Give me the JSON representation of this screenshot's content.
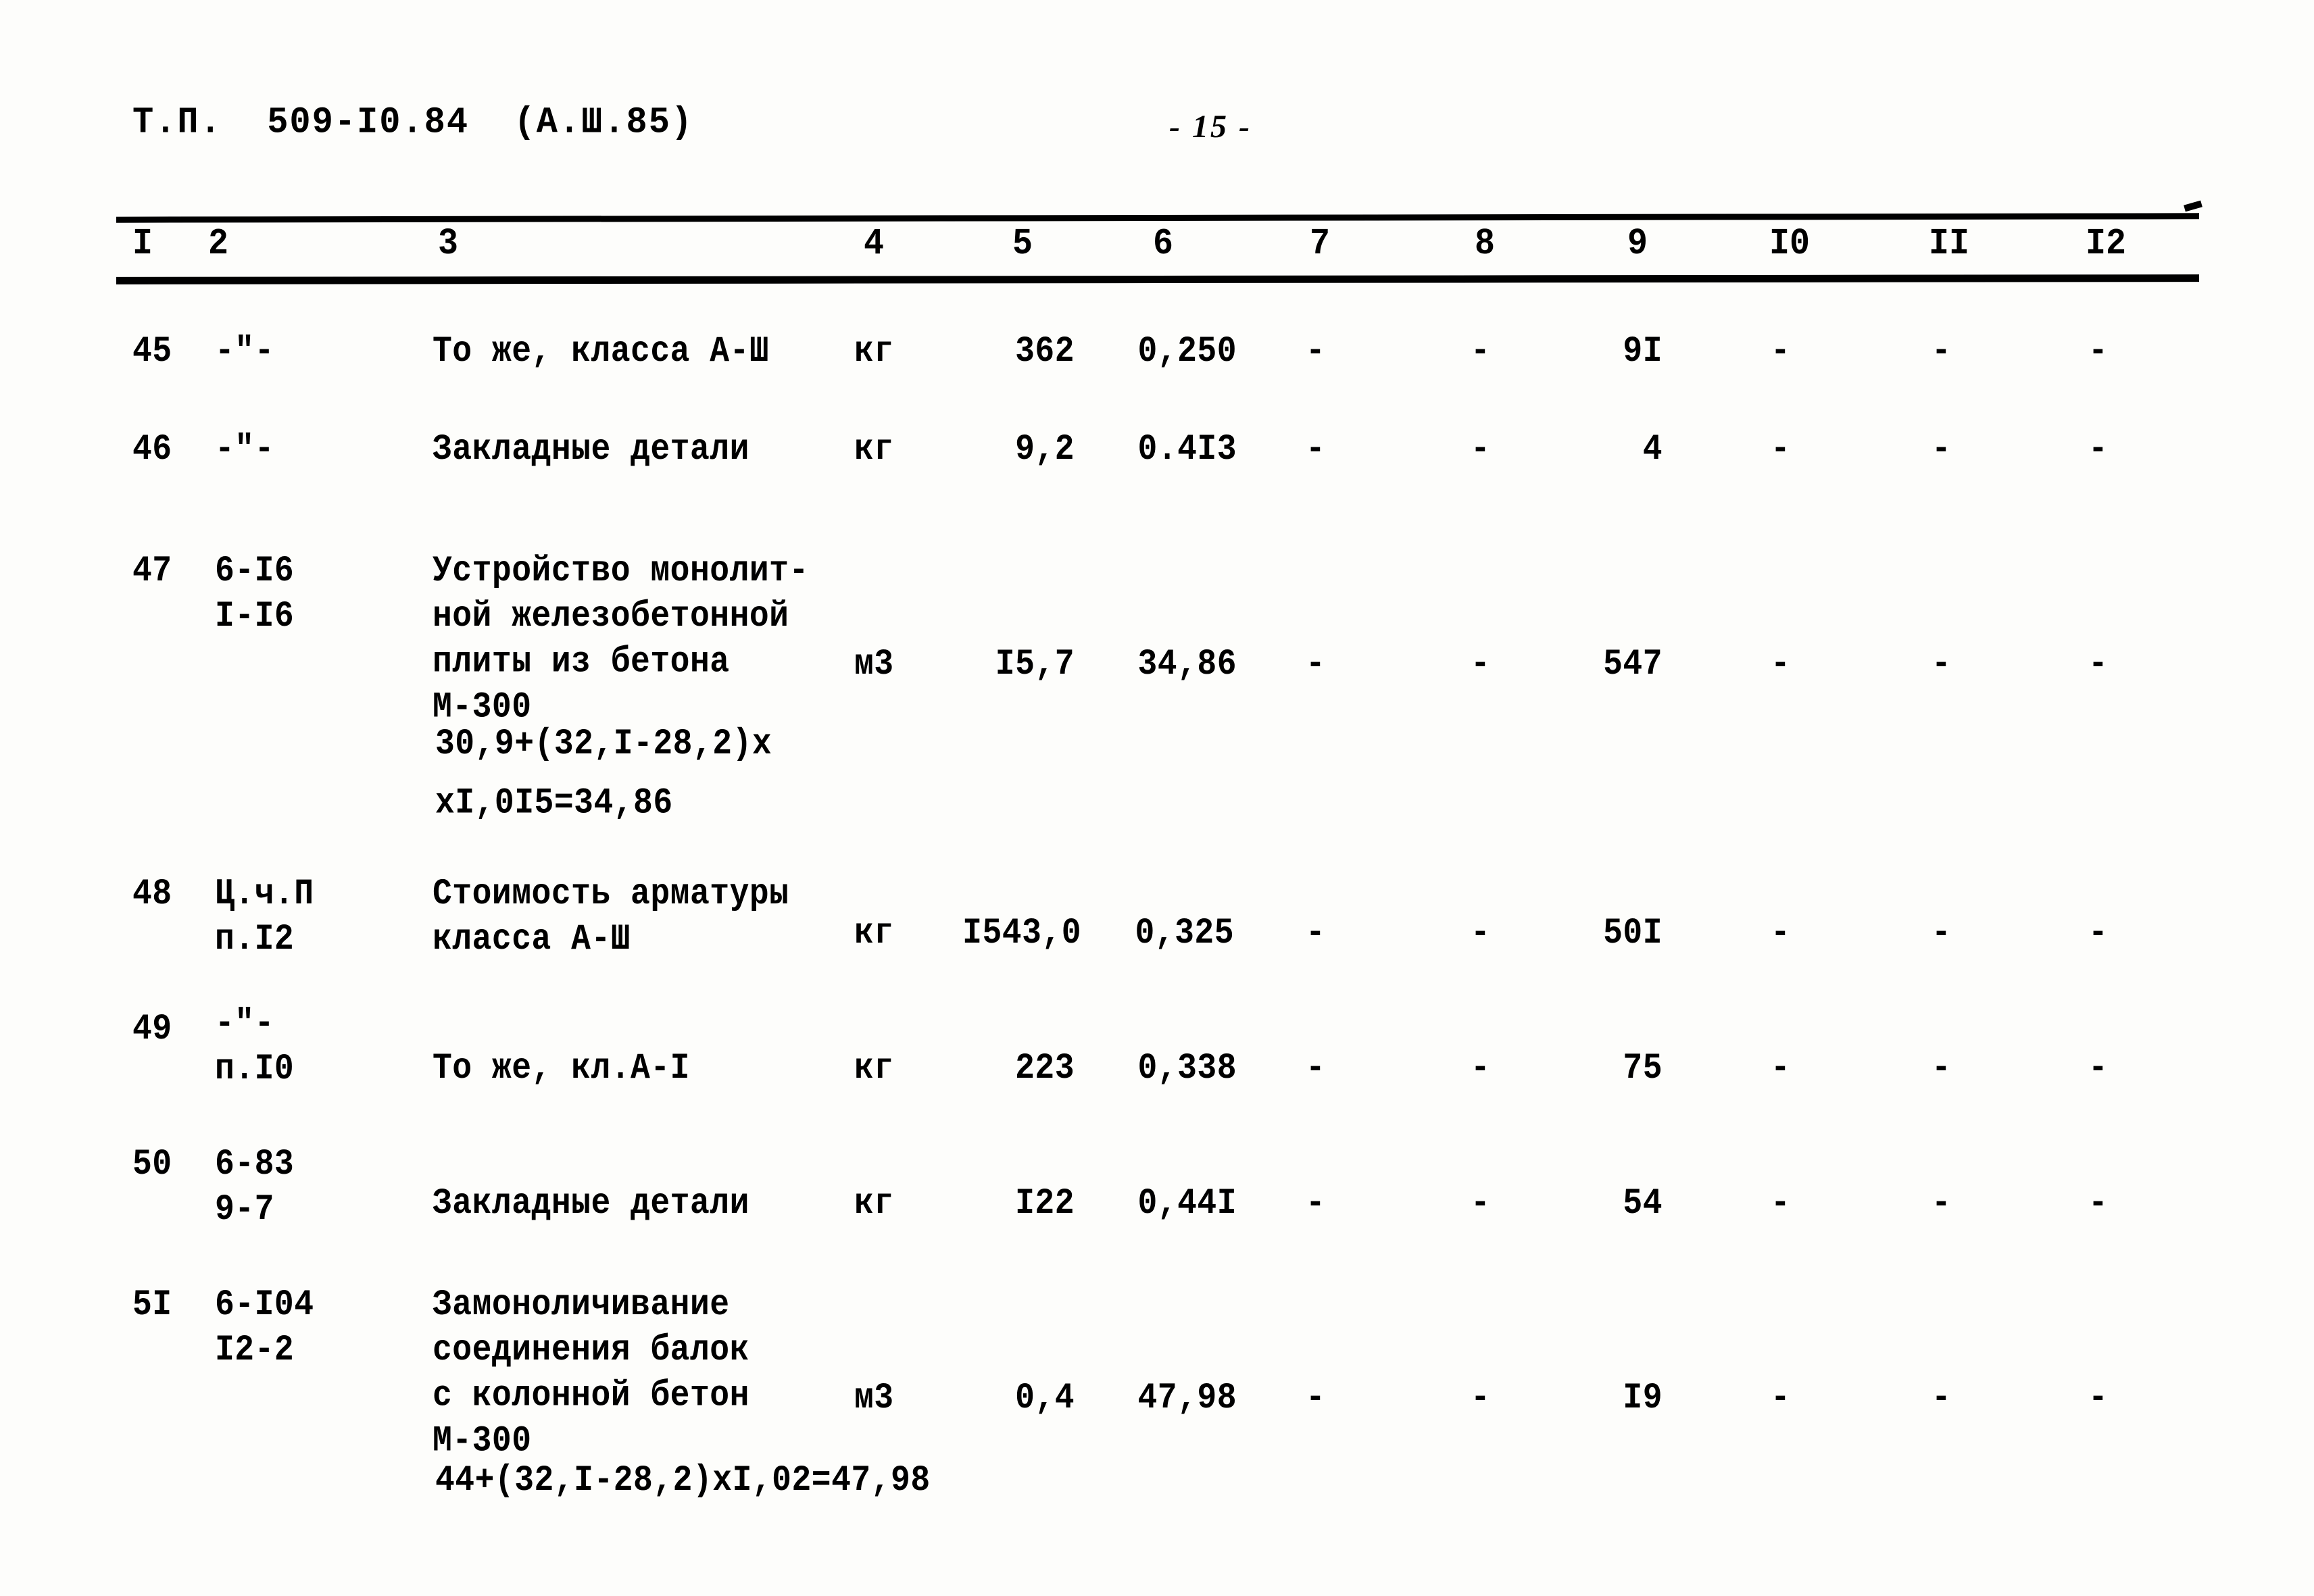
{
  "document": {
    "header_code": "Т.П.  509-I0.84  (А.Ш.85)",
    "page_number": "- 15 -"
  },
  "table": {
    "column_headers": [
      "I",
      "2",
      "3",
      "4",
      "5",
      "6",
      "7",
      "8",
      "9",
      "I0",
      "II",
      "I2"
    ],
    "rows": [
      {
        "c1": "45",
        "c2": "-\"-",
        "c3": "То же, класса А-Ш",
        "c4": "кг",
        "c5": "362",
        "c6": "0,250",
        "c7": "-",
        "c8": "-",
        "c9": "9I",
        "c10": "-",
        "c11": "-",
        "c12": "-",
        "formula": ""
      },
      {
        "c1": "46",
        "c2": "-\"-",
        "c3": "Закладные детали",
        "c4": "кг",
        "c5": "9,2",
        "c6": "0.4I3",
        "c7": "-",
        "c8": "-",
        "c9": "4",
        "c10": "-",
        "c11": "-",
        "c12": "-",
        "formula": ""
      },
      {
        "c1": "47",
        "c2": "6-I6\nI-I6",
        "c3": "Устройство монолит-\nной железобетонной\nплиты из бетона\nМ-300",
        "c4": "м3",
        "c5": "I5,7",
        "c6": "34,86",
        "c7": "-",
        "c8": "-",
        "c9": "547",
        "c10": "-",
        "c11": "-",
        "c12": "-",
        "formula": "30,9+(32,I-28,2)х\nхI,0I5=34,86"
      },
      {
        "c1": "48",
        "c2": "Ц.ч.П\nп.I2",
        "c3": "Стоимость арматуры\nкласса А-Ш",
        "c4": "кг",
        "c5": "I543,0",
        "c6": "0,325",
        "c7": "-",
        "c8": "-",
        "c9": "50I",
        "c10": "-",
        "c11": "-",
        "c12": "-",
        "formula": ""
      },
      {
        "c1": "49",
        "c2": "-\"-\nп.I0",
        "c3": "То же, кл.А-I",
        "c4": "кг",
        "c5": "223",
        "c6": "0,338",
        "c7": "-",
        "c8": "-",
        "c9": "75",
        "c10": "-",
        "c11": "-",
        "c12": "-",
        "formula": ""
      },
      {
        "c1": "50",
        "c2": "6-83\n9-7",
        "c3": "Закладные детали",
        "c4": "кг",
        "c5": "I22",
        "c6": "0,44I",
        "c7": "-",
        "c8": "-",
        "c9": "54",
        "c10": "-",
        "c11": "-",
        "c12": "-",
        "formula": ""
      },
      {
        "c1": "5I",
        "c2": "6-I04\nI2-2",
        "c3": "Замоноличивание\nсоединения балок\nс колонной бетон\nМ-300",
        "c4": "м3",
        "c5": "0,4",
        "c6": "47,98",
        "c7": "-",
        "c8": "-",
        "c9": "I9",
        "c10": "-",
        "c11": "-",
        "c12": "-",
        "formula": "44+(32,I-28,2)хI,02=47,98"
      }
    ]
  }
}
